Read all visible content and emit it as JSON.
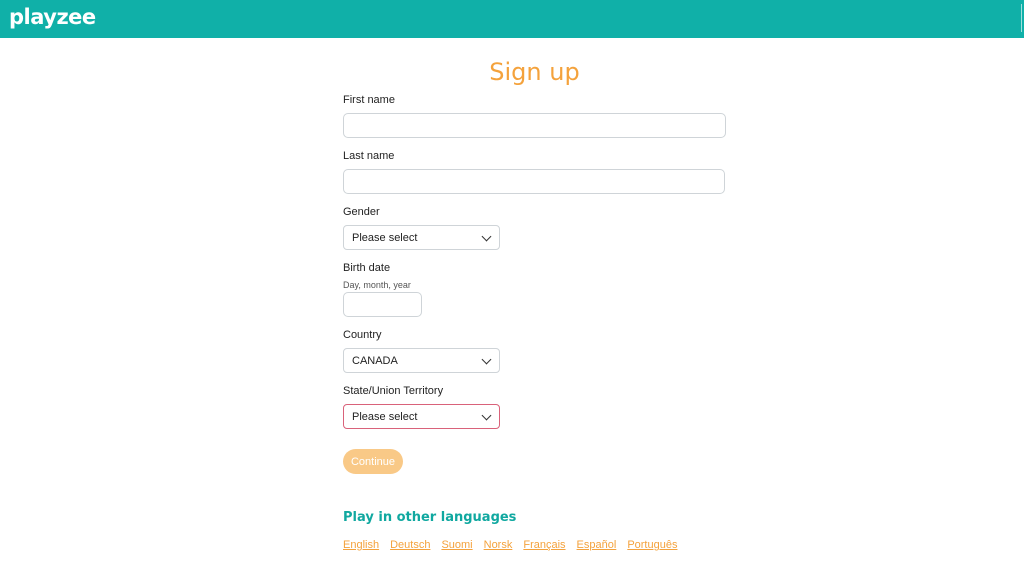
{
  "header": {
    "logo": "playzee"
  },
  "form": {
    "title": "Sign up",
    "first_name": {
      "label": "First name",
      "value": "",
      "placeholder": ""
    },
    "last_name": {
      "label": "Last name",
      "value": "",
      "placeholder": ""
    },
    "gender": {
      "label": "Gender",
      "selected": "Please select"
    },
    "birth_date": {
      "label": "Birth date",
      "hint": "Day, month, year",
      "value": ""
    },
    "country": {
      "label": "Country",
      "selected": "CANADA"
    },
    "state": {
      "label": "State/Union Territory",
      "selected": "Please select"
    },
    "continue_label": "Continue"
  },
  "languages": {
    "heading": "Play in other languages",
    "links": [
      "English",
      "Deutsch",
      "Suomi",
      "Norsk",
      "Français",
      "Español",
      "Português"
    ]
  },
  "colors": {
    "brand_teal": "#10b0a8",
    "accent_orange": "#f4a23c",
    "button_disabled": "#f9c987",
    "invalid_border": "#d9627a"
  },
  "icons": {
    "select_arrow": "chevron-down-icon"
  }
}
